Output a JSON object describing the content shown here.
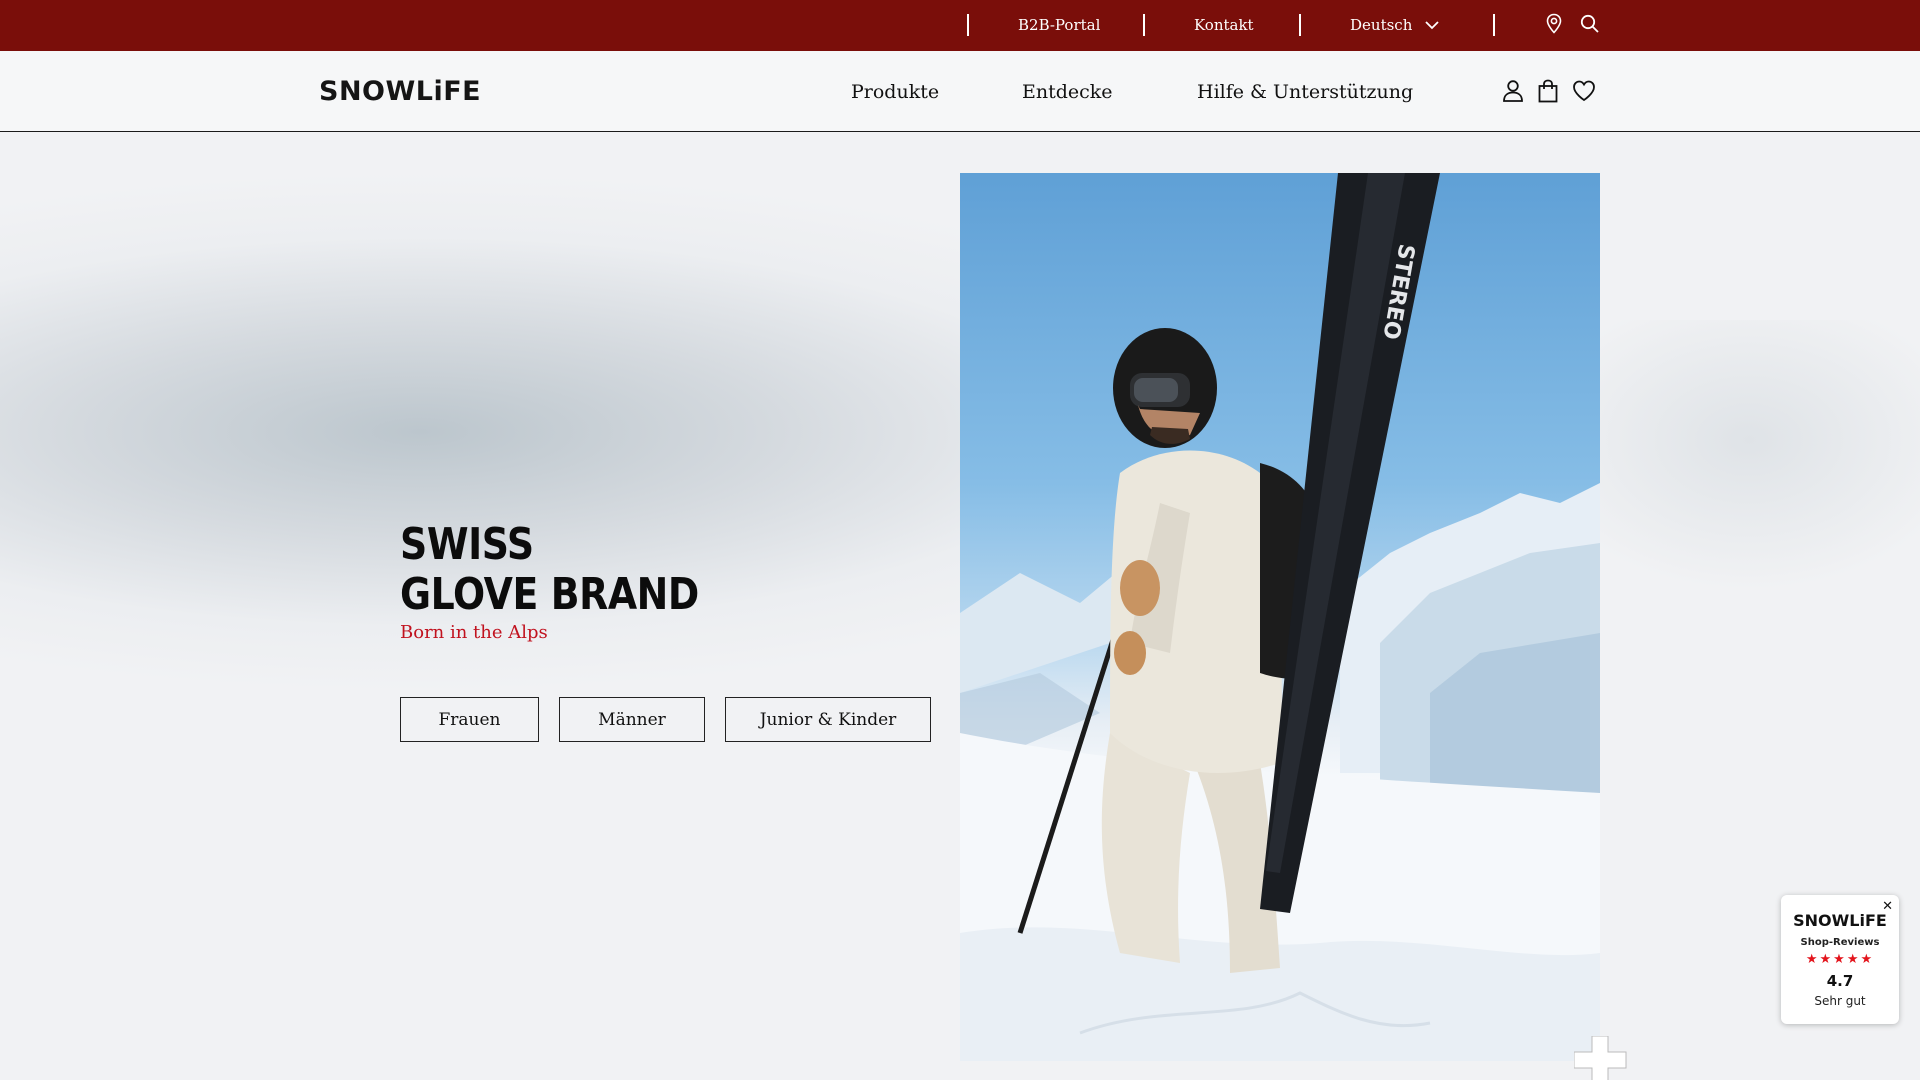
{
  "topbar": {
    "links": {
      "b2b": "B2B-Portal",
      "contact": "Kontakt",
      "language": "Deutsch"
    },
    "icons": [
      "chevron-down-icon",
      "location-pin-icon",
      "search-icon"
    ],
    "background_color": "#7a0e0a"
  },
  "header": {
    "logo": "SNOWLiFE",
    "nav": {
      "products": "Produkte",
      "discover": "Entdecke",
      "help": "Hilfe & Unterstützung"
    },
    "icons": [
      "account-icon",
      "shopping-bag-icon",
      "heart-icon"
    ]
  },
  "hero": {
    "title_line1": "SWISS",
    "title_line2": "GLOVE BRAND",
    "subtitle": "Born in the Alps",
    "subtitle_color": "#c1121f",
    "buttons": {
      "women": "Frauen",
      "men": "Männer",
      "kids": "Junior & Kinder"
    },
    "image_icon": "skier-in-snow-photo"
  },
  "review_widget": {
    "logo": "SNOWLiFE",
    "title": "Shop-Reviews",
    "stars": "★★★★★",
    "rating_stars": 4.7,
    "score": "4.7",
    "label": "Sehr gut",
    "close": "✕",
    "star_color": "#e3141c"
  }
}
